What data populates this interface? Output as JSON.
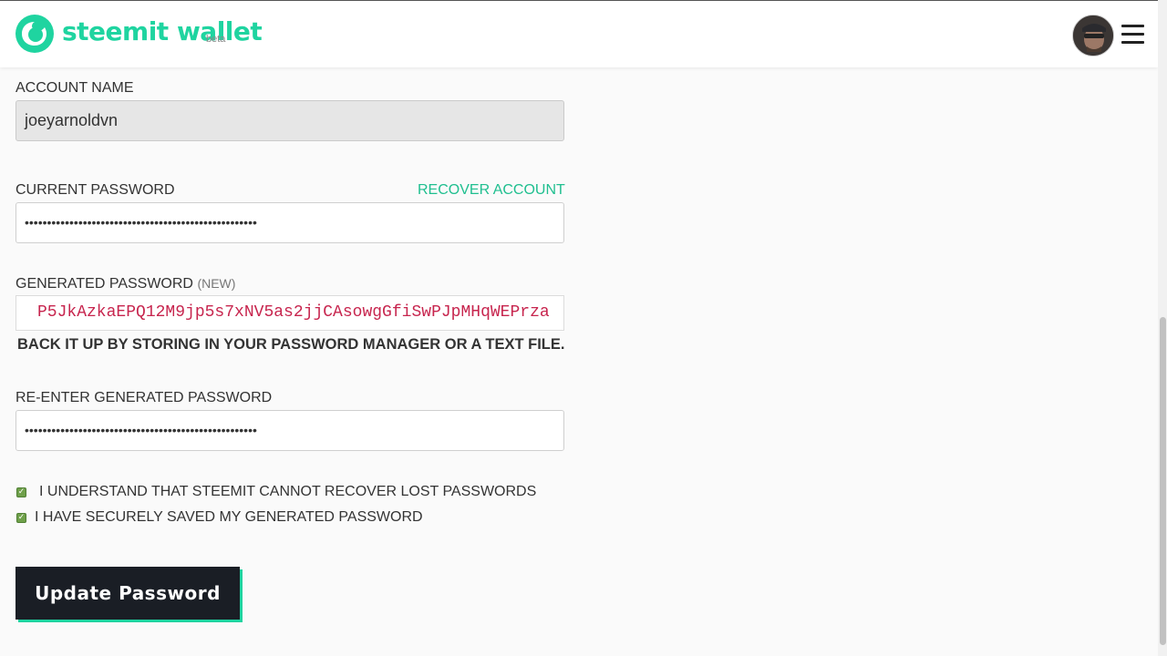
{
  "header": {
    "brand": "steemit wallet",
    "beta": "beta",
    "brand_color": "#1fd4a0"
  },
  "form": {
    "account_name_label": "ACCOUNT NAME",
    "account_name_value": "joeyarnoldvn",
    "current_password_label": "CURRENT PASSWORD",
    "recover_account_link": "RECOVER ACCOUNT",
    "current_password_value": "••••••••••••••••••••••••••••••••••••••••••••••••••••",
    "generated_password_label": "GENERATED PASSWORD",
    "generated_password_new": "(NEW)",
    "generated_password_value": "P5JkAzkaEPQ12M9jp5s7xNV5as2jjCAsowgGfiSwPJpMHqWEPrza",
    "backup_note": "BACK IT UP BY STORING IN YOUR PASSWORD MANAGER OR A TEXT FILE.",
    "reenter_label": "RE-ENTER GENERATED PASSWORD",
    "reenter_value": "••••••••••••••••••••••••••••••••••••••••••••••••••••",
    "checkbox_1": "I UNDERSTAND THAT STEEMIT CANNOT RECOVER LOST PASSWORDS",
    "checkbox_2": "I HAVE SECURELY SAVED MY GENERATED PASSWORD",
    "submit_label": "Update Password"
  },
  "icons": {
    "logo": "steemit-logo-icon",
    "avatar": "user-avatar",
    "menu": "hamburger-menu-icon",
    "check": "check-icon"
  }
}
